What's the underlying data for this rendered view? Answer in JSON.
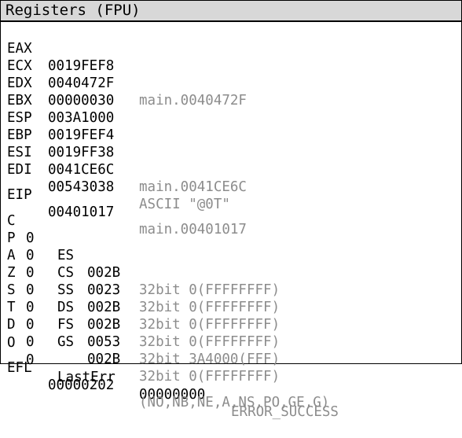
{
  "title": "Registers (FPU)",
  "registers": [
    {
      "name": "EAX",
      "value": "0019FEF8",
      "comment": ""
    },
    {
      "name": "ECX",
      "value": "0040472F",
      "comment": "main.0040472F"
    },
    {
      "name": "EDX",
      "value": "00000030",
      "comment": ""
    },
    {
      "name": "EBX",
      "value": "003A1000",
      "comment": ""
    },
    {
      "name": "ESP",
      "value": "0019FEF4",
      "comment": ""
    },
    {
      "name": "EBP",
      "value": "0019FF38",
      "comment": ""
    },
    {
      "name": "ESI",
      "value": "0041CE6C",
      "comment": "main.0041CE6C"
    },
    {
      "name": "EDI",
      "value": "00543038",
      "comment": "ASCII \"@0T\""
    }
  ],
  "eip": {
    "name": "EIP",
    "value": "00401017",
    "comment": "main.00401017"
  },
  "flags": [
    {
      "flag": "C",
      "value": "0",
      "seg": "ES",
      "seg_value": "002B",
      "seg_comment": "32bit 0(FFFFFFFF)"
    },
    {
      "flag": "P",
      "value": "0",
      "seg": "CS",
      "seg_value": "0023",
      "seg_comment": "32bit 0(FFFFFFFF)"
    },
    {
      "flag": "A",
      "value": "0",
      "seg": "SS",
      "seg_value": "002B",
      "seg_comment": "32bit 0(FFFFFFFF)"
    },
    {
      "flag": "Z",
      "value": "0",
      "seg": "DS",
      "seg_value": "002B",
      "seg_comment": "32bit 0(FFFFFFFF)"
    },
    {
      "flag": "S",
      "value": "0",
      "seg": "FS",
      "seg_value": "0053",
      "seg_comment": "32bit 3A4000(FFF)"
    },
    {
      "flag": "T",
      "value": "0",
      "seg": "GS",
      "seg_value": "002B",
      "seg_comment": "32bit 0(FFFFFFFF)"
    },
    {
      "flag": "D",
      "value": "0",
      "seg": "",
      "seg_value": "",
      "seg_comment": ""
    },
    {
      "flag": "O",
      "value": "0",
      "seg": "",
      "seg_value": "",
      "seg_comment": ""
    }
  ],
  "lasterr": {
    "label": "LastErr",
    "value": "00000000",
    "comment": "ERROR_SUCCESS"
  },
  "efl": {
    "name": "EFL",
    "value": "00000202",
    "comment": "(NO,NB,NE,A,NS,PO,GE,G)"
  },
  "colors": {
    "comment": "#8c8c8c",
    "titlebar": "#d8d8d8"
  }
}
